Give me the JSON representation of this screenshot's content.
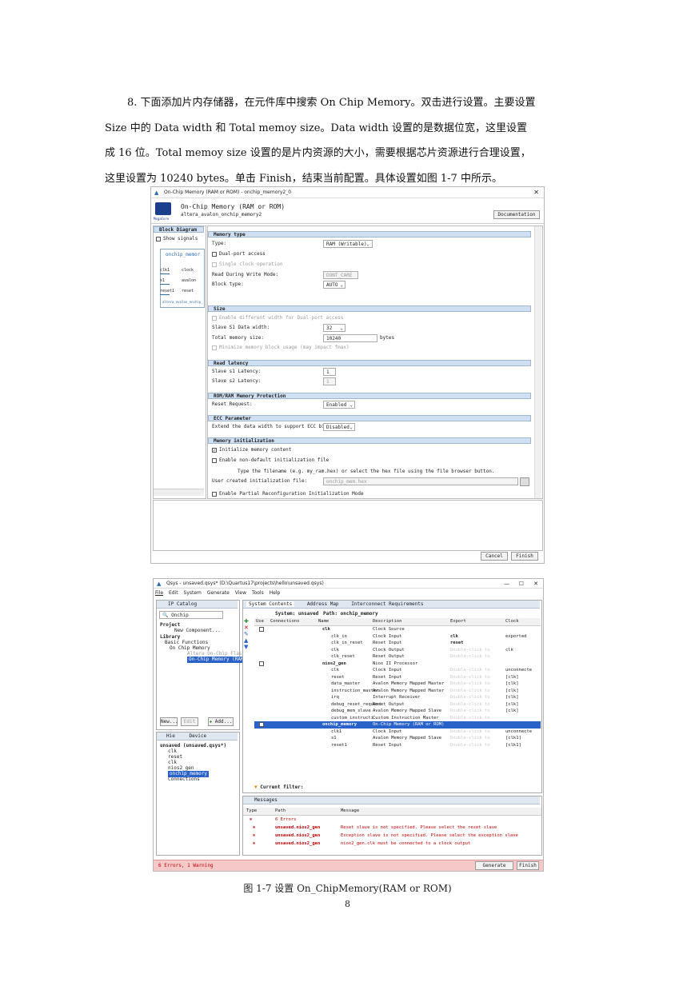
{
  "paragraph": {
    "lines": [
      "8. 下面添加片内存储器，在元件库中搜索 On Chip Memory。双击进行设置。主要设置",
      "Size 中的 Data width 和 Total memoy size。Data width 设置的是数据位宽，这里设置",
      "成 16 位。Total memoy size 设置的是片内资源的大小，需要根据芯片资源进行合理设置，",
      "这里设置为 10240 bytes。单击 Finish，结束当前配置。具体设置如图 1-7 中所示。"
    ]
  },
  "dialog": {
    "window_title": "On-Chip Memory (RAM or ROM) - onchip_memory2_0",
    "header_title": "On-Chip Memory (RAM or ROM)",
    "header_subtitle": "altera_avalon_onchip_memory2",
    "brand": "MegaCore",
    "documentation_button": "Documentation",
    "block_diagram_title": "Block Diagram",
    "show_signals": "Show signals",
    "block_name": "onchip_memor",
    "block_ports": [
      "clk1",
      "s1",
      "reset1"
    ],
    "block_ports_right": [
      "clock",
      "avalon",
      "reset"
    ],
    "block_footer": "altera_avalon_onchip_",
    "sections": {
      "memory_type": "Memory type",
      "size": "Size",
      "read_latency": "Read latency",
      "protection": "ROM/RAM Memory Protection",
      "ecc": "ECC Parameter",
      "init": "Memory initialization"
    },
    "type_label": "Type:",
    "type_value": "RAM (Writable)",
    "dual_port": "Dual-port access",
    "single_clock": "Single clock operation",
    "read_during_write_label": "Read During Write Mode:",
    "read_during_write_value": "DONT_CARE",
    "block_type_label": "Block type:",
    "block_type_value": "AUTO",
    "enable_diff_width": "Enable different width for Dual-port access",
    "data_width_label": "Slave S1 Data width:",
    "data_width_value": "32",
    "total_size_label": "Total memory size:",
    "total_size_value": "10240",
    "total_size_unit": "bytes",
    "minimize_block": "Minimize memory block usage (may impact fmax)",
    "slave_s1_latency_label": "Slave s1 Latency:",
    "slave_s1_latency_value": "1",
    "slave_s2_latency_label": "Slave s2 Latency:",
    "slave_s2_latency_value": "1",
    "reset_request_label": "Reset Request:",
    "reset_request_value": "Enabled",
    "ecc_label": "Extend the data width to support ECC bits:",
    "ecc_value": "Disabled",
    "init_content": "Initialize memory content",
    "non_default_init": "Enable non-default initialization file",
    "filename_hint": "Type the filename (e.g. my_ram.hex) or select the hex file using the file browser button.",
    "user_init_label": "User created initialization file:",
    "user_init_value": "onchip_mem.hex",
    "partial_reconfig": "Enable Partial Reconfiguration Initialization Mode",
    "cancel": "Cancel",
    "finish": "Finish"
  },
  "qsys": {
    "window_title": "Qsys - unsaved.qsys* (D:\\Quartus17\\projects\\hello\\unsaved.qsys)",
    "menu": [
      "File",
      "Edit",
      "System",
      "Generate",
      "View",
      "Tools",
      "Help"
    ],
    "ip_catalog_tab": "IP Catalog",
    "search_value": "Onchip",
    "tree": [
      "Project",
      "New Component...",
      "Library",
      "Basic Functions",
      "On Chip Memory",
      "Altera On-Chip Flash",
      "On-Chip Memory (RAM"
    ],
    "new_button": "New...",
    "edit_button": "Edit",
    "add_button": "Add...",
    "hierarchy_tab": "Hie",
    "device_tab": "Device",
    "hierarchy": [
      "unsaved (unsaved.qsys*)",
      "clk",
      "reset",
      "clk",
      "nios2_gen",
      "onchip_memory",
      "Connections"
    ],
    "tabs": [
      "System Contents",
      "Address Map",
      "Interconnect Requirements"
    ],
    "system_label": "System: unsaved",
    "path_label": "Path: onchip_memory",
    "columns": [
      "Use",
      "Connections",
      "Name",
      "Description",
      "Export",
      "Clock"
    ],
    "rows": [
      {
        "name": "clk",
        "desc": "Clock Source",
        "export": "",
        "clock": "",
        "bold": true
      },
      {
        "name": "clk_in",
        "desc": "Clock Input",
        "export": "clk",
        "clock": "exported",
        "bold": false
      },
      {
        "name": "clk_in_reset",
        "desc": "Reset Input",
        "export": "reset",
        "clock": "",
        "bold": false
      },
      {
        "name": "clk",
        "desc": "Clock Output",
        "export": "Double-click to",
        "clock": "clk",
        "bold": false
      },
      {
        "name": "clk_reset",
        "desc": "Reset Output",
        "export": "Double-click to",
        "clock": "",
        "bold": false
      },
      {
        "name": "nios2_gen",
        "desc": "Nios II Processor",
        "export": "",
        "clock": "",
        "bold": true
      },
      {
        "name": "clk",
        "desc": "Clock Input",
        "export": "Double-click to",
        "clock": "unconnecte",
        "bold": false
      },
      {
        "name": "reset",
        "desc": "Reset Input",
        "export": "Double-click to",
        "clock": "[clk]",
        "bold": false
      },
      {
        "name": "data_master",
        "desc": "Avalon Memory Mapped Master",
        "export": "Double-click to",
        "clock": "[clk]",
        "bold": false
      },
      {
        "name": "instruction_master",
        "desc": "Avalon Memory Mapped Master",
        "export": "Double-click to",
        "clock": "[clk]",
        "bold": false
      },
      {
        "name": "irq",
        "desc": "Interrupt Receiver",
        "export": "Double-click to",
        "clock": "[clk]",
        "bold": false
      },
      {
        "name": "debug_reset_request",
        "desc": "Reset Output",
        "export": "Double-click to",
        "clock": "[clk]",
        "bold": false
      },
      {
        "name": "debug_mem_slave",
        "desc": "Avalon Memory Mapped Slave",
        "export": "Double-click to",
        "clock": "[clk]",
        "bold": false
      },
      {
        "name": "custom_instructi",
        "desc": "Custom Instruction Master",
        "export": "Double-click to",
        "clock": "",
        "bold": false
      },
      {
        "name": "onchip_memory",
        "desc": "On-Chip Memory (RAM or ROM)",
        "export": "",
        "clock": "",
        "bold": true
      },
      {
        "name": "clk1",
        "desc": "Clock Input",
        "export": "Double-click to",
        "clock": "unconnecte",
        "bold": false
      },
      {
        "name": "s1",
        "desc": "Avalon Memory Mapped Slave",
        "export": "Double-click to",
        "clock": "[clk1]",
        "bold": false
      },
      {
        "name": "reset1",
        "desc": "Reset Input",
        "export": "Double-click to",
        "clock": "[clk1]",
        "bold": false
      }
    ],
    "filter_label": "Current filter:",
    "messages_tab": "Messages",
    "msg_columns": [
      "Type",
      "Path",
      "Message"
    ],
    "messages": [
      {
        "path": "6 Errors",
        "message": ""
      },
      {
        "path": "unsaved.nios2_gen",
        "message": "Reset slave is not specified. Please select the reset slave"
      },
      {
        "path": "unsaved.nios2_gen",
        "message": "Exception slave is not specified. Please select the exception slave"
      },
      {
        "path": "unsaved.nios2_gen",
        "message": "nios2_gen.clk must be connected to a clock output"
      }
    ],
    "status": "6 Errors, 1 Warning",
    "generate_button": "Generate HDL...",
    "finish_button": "Finish"
  },
  "caption": "图 1-7  设置 On_ChipMemory(RAM or ROM)",
  "page_number": "8"
}
